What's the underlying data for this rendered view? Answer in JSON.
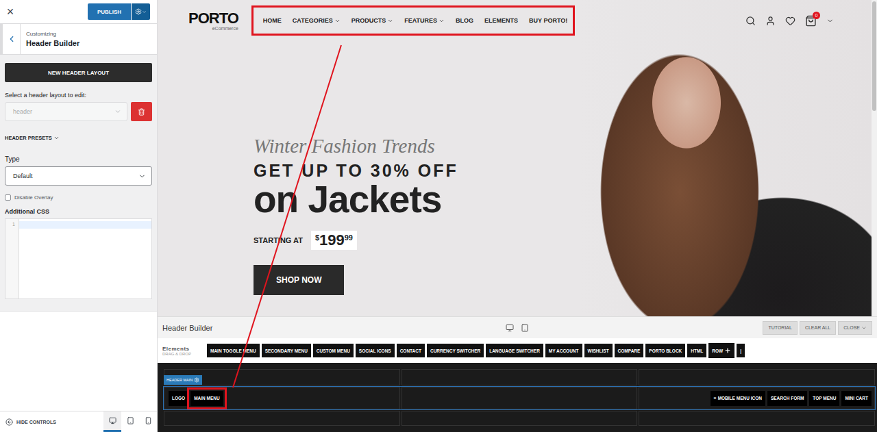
{
  "customizer": {
    "close": "×",
    "publish": "PUBLISH",
    "breadcrumb": "Customizing",
    "title": "Header Builder",
    "new_layout": "NEW HEADER LAYOUT",
    "layout_label": "Select a header layout to edit:",
    "layout_select": {
      "value": "header",
      "disabled": true
    },
    "presets": {
      "label": "HEADER PRESETS",
      "expanded": false
    },
    "type": {
      "label": "Type",
      "value": "Default"
    },
    "disable_overlay": {
      "label": "Disable Overlay",
      "checked": false
    },
    "additional_css": {
      "label": "Additional CSS",
      "lines": [
        "1"
      ]
    },
    "hide_controls": "HIDE CONTROLS",
    "devices": [
      {
        "kind": "desktop",
        "selected": true
      },
      {
        "kind": "tablet",
        "selected": false
      },
      {
        "kind": "mobile",
        "selected": false
      }
    ]
  },
  "preview": {
    "logo": {
      "name": "PORTO",
      "tagline": "eCommerce"
    },
    "menu": {
      "highlighted": true,
      "items": [
        {
          "label": "HOME",
          "dropdown": false
        },
        {
          "label": "CATEGORIES",
          "dropdown": true
        },
        {
          "label": "PRODUCTS",
          "dropdown": true
        },
        {
          "label": "FEATURES",
          "dropdown": true
        },
        {
          "label": "BLOG",
          "dropdown": false
        },
        {
          "label": "ELEMENTS",
          "dropdown": false
        },
        {
          "label": "BUY PORTO!",
          "dropdown": false
        }
      ]
    },
    "cart_count": "0",
    "hero": {
      "kicker": "Winter Fashion Trends",
      "headline": "GET UP TO 30% OFF",
      "title": "on Jackets",
      "price_label": "STARTING AT",
      "currency": "$",
      "amount": "199",
      "cents": "99",
      "button": "SHOP NOW"
    }
  },
  "builder": {
    "title": "Header Builder",
    "devices": [
      {
        "kind": "desktop"
      },
      {
        "kind": "tablet"
      }
    ],
    "actions": [
      {
        "label": "TUTORIAL",
        "dropdown": false
      },
      {
        "label": "CLEAR ALL",
        "dropdown": false
      },
      {
        "label": "CLOSE",
        "dropdown": true
      }
    ],
    "elements_label": "Elements",
    "elements_hint": "DRAG & DROP",
    "elements": [
      "MAIN TOGGLE MENU",
      "SECONDARY MENU",
      "CUSTOM MENU",
      "SOCIAL ICONS",
      "CONTACT",
      "CURRENCY SWITCHER",
      "LANGUAGE SWITCHER",
      "MY ACCOUNT",
      "WISHLIST",
      "COMPARE",
      "PORTO BLOCK",
      "HTML"
    ],
    "add_row": "ROW",
    "divider": "|",
    "row_tag": "HEADER MAIN",
    "columns": [
      {
        "items": [
          {
            "label": "LOGO",
            "icon": "",
            "highlighted": false
          },
          {
            "label": "MAIN MENU",
            "icon": "",
            "highlighted": true
          }
        ]
      },
      {
        "items": []
      },
      {
        "items": [
          {
            "label": "MOBILE MENU ICON",
            "icon": "≡",
            "highlighted": false
          },
          {
            "label": "SEARCH FORM",
            "icon": "",
            "highlighted": false
          },
          {
            "label": "TOP MENU",
            "icon": "",
            "highlighted": false
          },
          {
            "label": "MINI CART",
            "icon": "",
            "highlighted": false
          }
        ]
      }
    ]
  }
}
